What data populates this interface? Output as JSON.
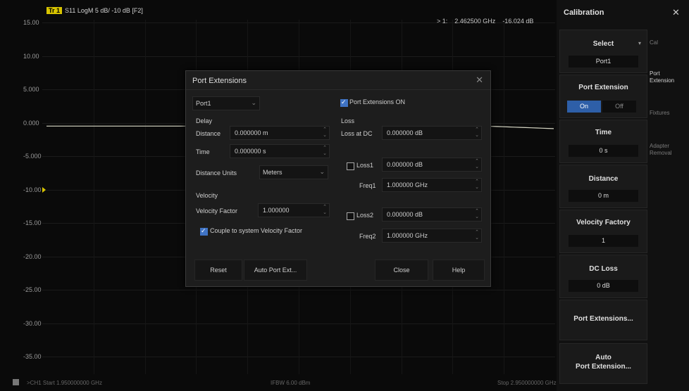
{
  "trace": {
    "badge": "Tr 1",
    "label": "S11 LogM 5 dB/ -10 dB [F2]",
    "marker_id": "> 1:",
    "marker_freq": "2.462500 GHz",
    "marker_value": "-16.024 dB",
    "y_ticks": [
      "15.00",
      "10.00",
      "5.000",
      "0.000",
      "-5.000",
      "-10.00",
      "-15.00",
      "-20.00",
      "-25.00",
      "-30.00",
      "-35.00"
    ],
    "ref_level": -10,
    "trace_level_db": -0.5
  },
  "bottom_bar": {
    "channel_start": ">CH1  Start 1.950000000 GHz",
    "power": "IFBW 6.00 dBm",
    "stop": "Stop 2.950000000 GHz"
  },
  "dialog": {
    "title": "Port Extensions",
    "port_select": "Port1",
    "port_ext_on_label": "Port Extensions ON",
    "port_ext_on_checked": true,
    "delay_section": "Delay",
    "distance_label": "Distance",
    "distance_value": "0.000000 m",
    "time_label": "Time",
    "time_value": "0.000000 s",
    "distance_units_label": "Distance Units",
    "distance_units_value": "Meters",
    "velocity_section": "Velocity",
    "velocity_factor_label": "Velocity Factor",
    "velocity_factor_value": "1.000000",
    "couple_label": "Couple to system Velocity Factor",
    "couple_checked": true,
    "loss_section": "Loss",
    "loss_dc_label": "Loss at DC",
    "loss_dc_value": "0.000000 dB",
    "loss1_label": "Loss1",
    "loss1_value": "0.000000 dB",
    "loss1_checked": false,
    "freq1_label": "Freq1",
    "freq1_value": "1.000000 GHz",
    "loss2_label": "Loss2",
    "loss2_value": "0.000000 dB",
    "loss2_checked": false,
    "freq2_label": "Freq2",
    "freq2_value": "1.000000 GHz",
    "reset_label": "Reset",
    "auto_port_label": "Auto Port Ext...",
    "close_label": "Close",
    "help_label": "Help"
  },
  "panel": {
    "title": "Calibration",
    "select_label": "Select",
    "select_value": "Port1",
    "port_extension_label": "Port Extension",
    "on_label": "On",
    "off_label": "Off",
    "time_label": "Time",
    "time_value": "0 s",
    "distance_label": "Distance",
    "distance_value": "0 m",
    "velocity_label": "Velocity Factory",
    "velocity_value": "1",
    "dc_loss_label": "DC Loss",
    "dc_loss_value": "0 dB",
    "port_extensions_btn": "Port Extensions...",
    "auto_port_line1": "Auto",
    "auto_port_line2": "Port Extension...",
    "tabs": [
      "Cal",
      "Port Extension",
      "Fixtures",
      "Adapter Removal"
    ],
    "active_tab": "Port Extension",
    "accent_color": "#2e5fa8"
  }
}
